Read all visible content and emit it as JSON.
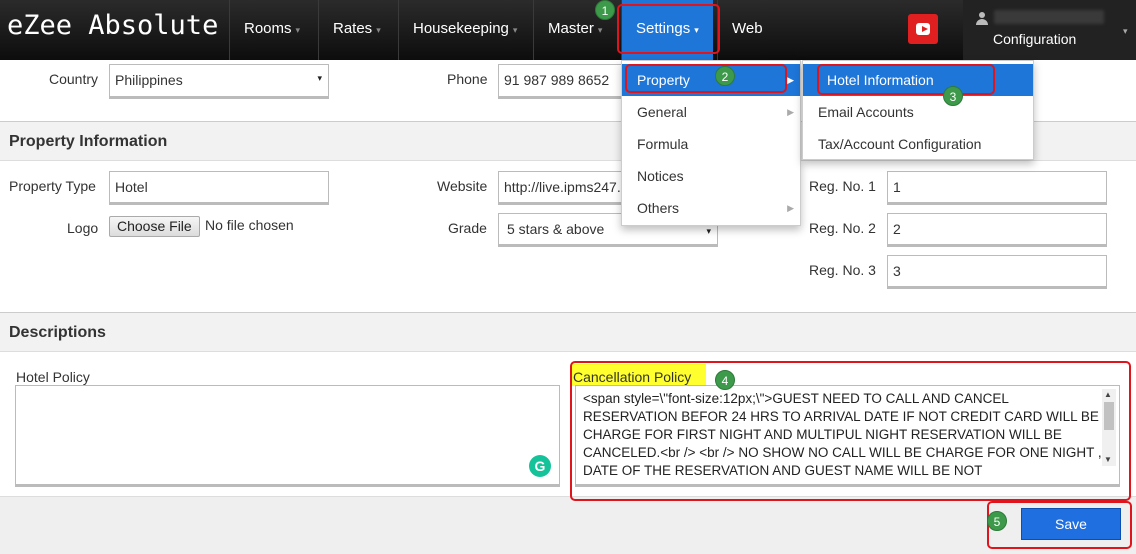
{
  "brand": "eZee Absolute",
  "nav": {
    "rooms": "Rooms",
    "rates": "Rates",
    "housekeeping": "Housekeeping",
    "master": "Master",
    "settings": "Settings",
    "web": "Web",
    "configuration": "Configuration",
    "caret": "▾"
  },
  "contact": {
    "country_label": "Country",
    "country_value": "Philippines",
    "phone_label": "Phone",
    "phone_value": "91 987 989 8652"
  },
  "property_info": {
    "heading": "Property Information",
    "type_label": "Property Type",
    "type_value": "Hotel",
    "logo_label": "Logo",
    "choose_file": "Choose File",
    "no_file": "No file chosen",
    "website_label": "Website",
    "website_value": "http://live.ipms247.",
    "grade_label": "Grade",
    "grade_value": "5 stars & above",
    "reg1_label": "Reg. No. 1",
    "reg1_value": "1",
    "reg2_label": "Reg. No. 2",
    "reg2_value": "2",
    "reg3_label": "Reg. No. 3",
    "reg3_value": "3"
  },
  "descriptions": {
    "heading": "Descriptions",
    "hotel_policy_label": "Hotel Policy",
    "hotel_policy_value": "",
    "cancellation_label": "Cancellation Policy",
    "cancellation_value": "<span style=\\\"font-size:12px;\\\">GUEST NEED TO CALL AND CANCEL RESERVATION BEFOR  24 HRS TO ARRIVAL DATE IF NOT CREDIT CARD WILL BE CHARGE FOR FIRST NIGHT AND MULTIPUL NIGHT RESERVATION WILL BE CANCELED.<br /> <br /> NO SHOW NO CALL WILL BE CHARGE FOR ONE NIGHT , DATE OF THE RESERVATION AND GUEST NAME WILL BE NOT"
  },
  "save_label": "Save",
  "settings_menu": {
    "items": [
      "Property",
      "General",
      "Formula",
      "Notices",
      "Others"
    ]
  },
  "property_submenu": {
    "items": [
      "Hotel Information",
      "Email Accounts",
      "Tax/Account Configuration"
    ]
  },
  "badges": [
    "1",
    "2",
    "3",
    "4",
    "5"
  ],
  "colors": {
    "accent": "#1e76d9",
    "annotation": "#e0141c",
    "badge": "#3c9a4a",
    "highlight": "#ffff2e"
  }
}
